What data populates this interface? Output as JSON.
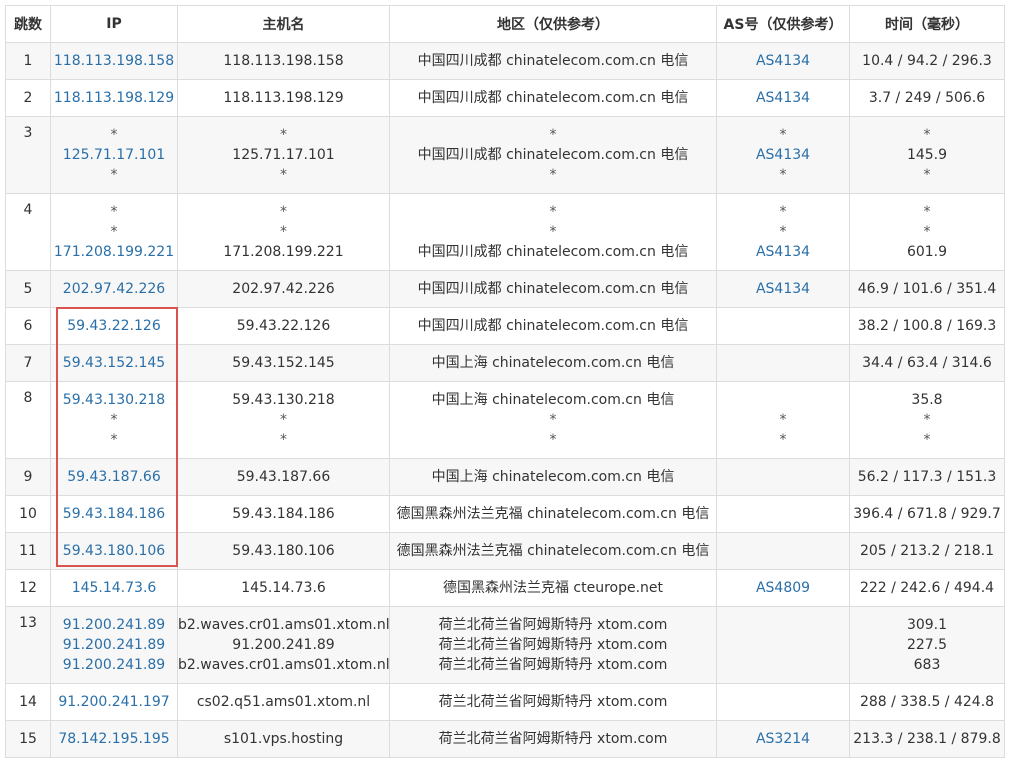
{
  "headers": {
    "hop": "跳数",
    "ip": "IP",
    "host": "主机名",
    "region": "地区（仅供参考）",
    "as": "AS号（仅供参考）",
    "time": "时间（毫秒）"
  },
  "highlight_color": "#d9534f",
  "link_color": "#2a6fa8",
  "rows": [
    {
      "hop": "1",
      "ip": [
        "118.113.198.158"
      ],
      "host": [
        "118.113.198.158"
      ],
      "region": [
        "中国四川成都 chinatelecom.com.cn 电信"
      ],
      "as": [
        "AS4134"
      ],
      "time": [
        "10.4 / 94.2 / 296.3"
      ]
    },
    {
      "hop": "2",
      "ip": [
        "118.113.198.129"
      ],
      "host": [
        "118.113.198.129"
      ],
      "region": [
        "中国四川成都 chinatelecom.com.cn 电信"
      ],
      "as": [
        "AS4134"
      ],
      "time": [
        "3.7 / 249 / 506.6"
      ]
    },
    {
      "hop": "3",
      "ip": [
        "*",
        "125.71.17.101",
        "*"
      ],
      "host": [
        "*",
        "125.71.17.101",
        "*"
      ],
      "region": [
        "*",
        "中国四川成都 chinatelecom.com.cn 电信",
        "*"
      ],
      "as": [
        "*",
        "AS4134",
        "*"
      ],
      "time": [
        "*",
        "145.9",
        "*"
      ]
    },
    {
      "hop": "4",
      "ip": [
        "*",
        "*",
        "171.208.199.221"
      ],
      "host": [
        "*",
        "*",
        "171.208.199.221"
      ],
      "region": [
        "*",
        "*",
        "中国四川成都 chinatelecom.com.cn 电信"
      ],
      "as": [
        "*",
        "*",
        "AS4134"
      ],
      "time": [
        "*",
        "*",
        "601.9"
      ]
    },
    {
      "hop": "5",
      "ip": [
        "202.97.42.226"
      ],
      "host": [
        "202.97.42.226"
      ],
      "region": [
        "中国四川成都 chinatelecom.com.cn 电信"
      ],
      "as": [
        "AS4134"
      ],
      "time": [
        "46.9 / 101.6 / 351.4"
      ]
    },
    {
      "hop": "6",
      "ip": [
        "59.43.22.126"
      ],
      "host": [
        "59.43.22.126"
      ],
      "region": [
        "中国四川成都 chinatelecom.com.cn 电信"
      ],
      "as": [
        ""
      ],
      "time": [
        "38.2 / 100.8 / 169.3"
      ]
    },
    {
      "hop": "7",
      "ip": [
        "59.43.152.145"
      ],
      "host": [
        "59.43.152.145"
      ],
      "region": [
        "中国上海 chinatelecom.com.cn 电信"
      ],
      "as": [
        ""
      ],
      "time": [
        "34.4 / 63.4 / 314.6"
      ]
    },
    {
      "hop": "8",
      "ip": [
        "59.43.130.218",
        "*",
        "*"
      ],
      "host": [
        "59.43.130.218",
        "*",
        "*"
      ],
      "region": [
        "中国上海 chinatelecom.com.cn 电信",
        "*",
        "*"
      ],
      "as": [
        "",
        "*",
        "*"
      ],
      "time": [
        "35.8",
        "*",
        "*"
      ]
    },
    {
      "hop": "9",
      "ip": [
        "59.43.187.66"
      ],
      "host": [
        "59.43.187.66"
      ],
      "region": [
        "中国上海 chinatelecom.com.cn 电信"
      ],
      "as": [
        ""
      ],
      "time": [
        "56.2 / 117.3 / 151.3"
      ]
    },
    {
      "hop": "10",
      "ip": [
        "59.43.184.186"
      ],
      "host": [
        "59.43.184.186"
      ],
      "region": [
        "德国黑森州法兰克福 chinatelecom.com.cn 电信"
      ],
      "as": [
        ""
      ],
      "time": [
        "396.4 / 671.8 / 929.7"
      ]
    },
    {
      "hop": "11",
      "ip": [
        "59.43.180.106"
      ],
      "host": [
        "59.43.180.106"
      ],
      "region": [
        "德国黑森州法兰克福 chinatelecom.com.cn 电信"
      ],
      "as": [
        ""
      ],
      "time": [
        "205 / 213.2 / 218.1"
      ]
    },
    {
      "hop": "12",
      "ip": [
        "145.14.73.6"
      ],
      "host": [
        "145.14.73.6"
      ],
      "region": [
        "德国黑森州法兰克福 cteurope.net"
      ],
      "as": [
        "AS4809"
      ],
      "time": [
        "222 / 242.6 / 494.4"
      ]
    },
    {
      "hop": "13",
      "ip": [
        "91.200.241.89",
        "91.200.241.89",
        "91.200.241.89"
      ],
      "host": [
        "b2.waves.cr01.ams01.xtom.nl",
        "91.200.241.89",
        "b2.waves.cr01.ams01.xtom.nl"
      ],
      "region": [
        "荷兰北荷兰省阿姆斯特丹 xtom.com",
        "荷兰北荷兰省阿姆斯特丹 xtom.com",
        "荷兰北荷兰省阿姆斯特丹 xtom.com"
      ],
      "as": [
        "",
        "",
        ""
      ],
      "time": [
        "309.1",
        "227.5",
        "683"
      ]
    },
    {
      "hop": "14",
      "ip": [
        "91.200.241.197"
      ],
      "host": [
        "cs02.q51.ams01.xtom.nl"
      ],
      "region": [
        "荷兰北荷兰省阿姆斯特丹 xtom.com"
      ],
      "as": [
        ""
      ],
      "time": [
        "288 / 338.5 / 424.8"
      ]
    },
    {
      "hop": "15",
      "ip": [
        "78.142.195.195"
      ],
      "host": [
        "s101.vps.hosting"
      ],
      "region": [
        "荷兰北荷兰省阿姆斯特丹 xtom.com"
      ],
      "as": [
        "AS3214"
      ],
      "time": [
        "213.3 / 238.1 / 879.8"
      ]
    }
  ]
}
